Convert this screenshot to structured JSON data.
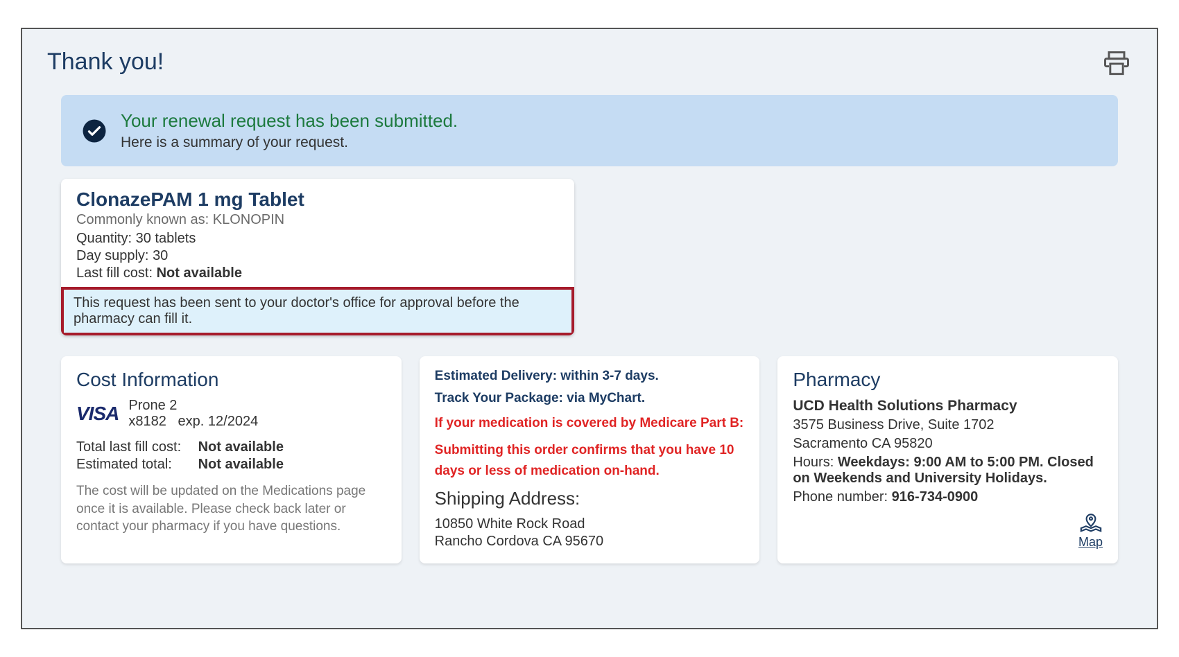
{
  "header": {
    "title": "Thank you!"
  },
  "banner": {
    "title": "Your renewal request has been submitted.",
    "sub": "Here is a summary of your request."
  },
  "med": {
    "name": "ClonazePAM 1 mg Tablet",
    "known": "Commonly known as: KLONOPIN",
    "qty_label": "Quantity:",
    "qty_val": "30 tablets",
    "supply_label": "Day supply:",
    "supply_val": "30",
    "lastfill_label": "Last fill cost:",
    "lastfill_val": "Not available",
    "notice": "This request has been sent to your doctor's office for approval before the pharmacy can fill it."
  },
  "cost": {
    "title": "Cost Information",
    "card_brand": "VISA",
    "card_name": "Prone 2",
    "card_masked": "x8182",
    "card_exp": "exp. 12/2024",
    "total_last_label": "Total last fill cost:",
    "total_last_val": "Not available",
    "est_total_label": "Estimated total:",
    "est_total_val": "Not available",
    "note": "The cost will be updated on the Medications page once it is available. Please check back later or contact your pharmacy if you have questions."
  },
  "ship": {
    "delivery": "Estimated Delivery: within 3-7 days.",
    "track": "Track Your Package: via MyChart.",
    "medicare": "If your medication is covered by Medicare Part B:",
    "confirm": "Submitting this order confirms that you have 10 days or less of medication on-hand.",
    "title": "Shipping Address:",
    "line1": "10850 White Rock Road",
    "line2": "Rancho Cordova CA 95670"
  },
  "pharmacy": {
    "title": "Pharmacy",
    "name": "UCD Health Solutions Pharmacy",
    "addr1": "3575 Business Drive, Suite 1702",
    "addr2": "Sacramento CA 95820",
    "hours_label": "Hours:",
    "hours_val": "Weekdays: 9:00 AM to 5:00 PM. Closed on Weekends and University Holidays.",
    "phone_label": "Phone number:",
    "phone_val": "916-734-0900",
    "map_label": "Map"
  }
}
